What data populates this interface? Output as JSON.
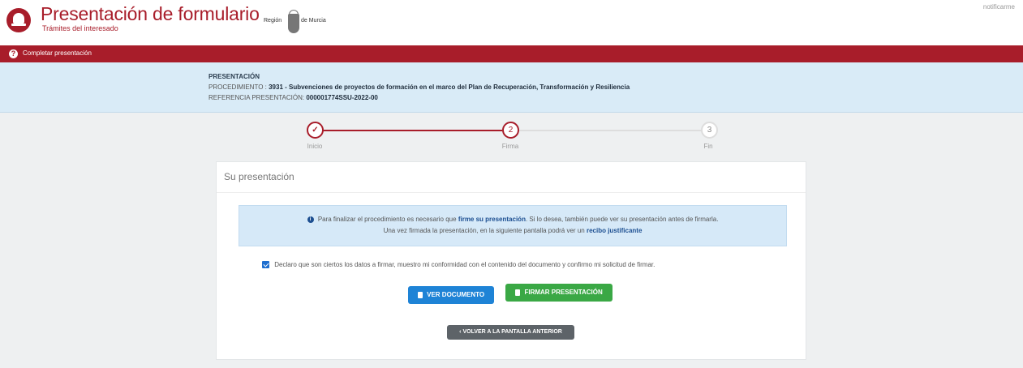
{
  "header": {
    "title": "Presentación de formulario",
    "subtitle": "Trámites del interesado",
    "region_left": "Región",
    "region_right": "de Murcia",
    "user_link": "notificarme"
  },
  "status_bar": {
    "label": "Completar presentación"
  },
  "info": {
    "title": "PRESENTACIÓN",
    "procedure_label": "PROCEDIMIENTO :",
    "procedure_value": "3931 - Subvenciones de proyectos de formación en el marco del Plan de Recuperación, Transformación y Resiliencia",
    "reference_label": "REFERENCIA PRESENTACIÓN:",
    "reference_value": "000001774SSU-2022-00"
  },
  "stepper": {
    "steps": [
      {
        "num": "✓",
        "label": "Inicio"
      },
      {
        "num": "2",
        "label": "Firma"
      },
      {
        "num": "3",
        "label": "Fin"
      }
    ]
  },
  "card": {
    "title": "Su presentación",
    "alert_text_1": "Para finalizar el procedimiento es necesario que",
    "alert_bold_1": "firme su presentación",
    "alert_text_2": ". Si lo desea, también puede ver su presentación antes de firmarla.",
    "alert_text_3": "Una vez firmada la presentación, en la siguiente pantalla podrá ver un",
    "alert_bold_2": "recibo justificante",
    "checkbox_label": "Declaro que son ciertos los datos a firmar, muestro mi conformidad con el contenido del documento y confirmo mi solicitud de firmar.",
    "btn_doc": "VER DOCUMENTO",
    "btn_sign": "FIRMAR PRESENTACIÓN",
    "btn_back": "VOLVER A LA PANTALLA ANTERIOR"
  },
  "colors": {
    "brand_red": "#a81d2a",
    "info_bg": "#d9ebf7",
    "btn_blue": "#1e83d6",
    "btn_green": "#3aa845",
    "btn_grey": "#5d6368"
  }
}
